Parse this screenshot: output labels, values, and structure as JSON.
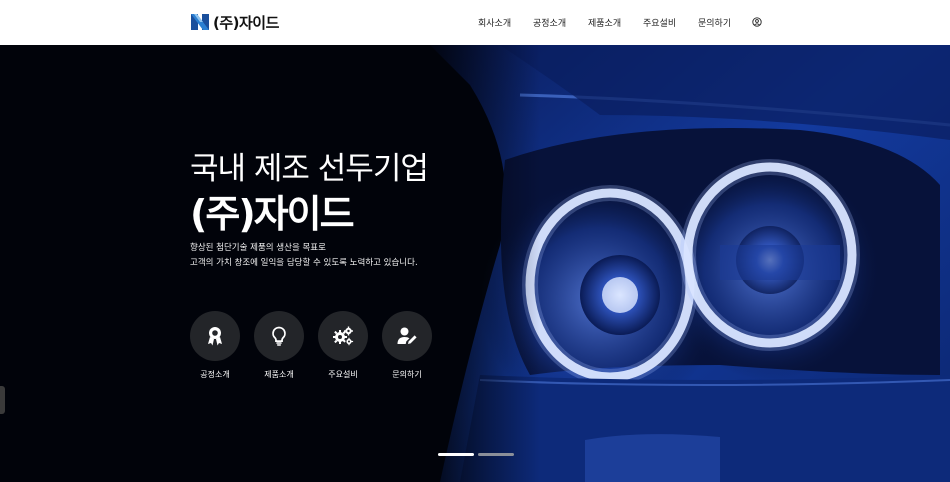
{
  "brand": {
    "name": "(주)자이드",
    "logo_icon": "zaid-logo-icon",
    "colors": {
      "primary": "#1a4f9c",
      "accent": "#2b7fd1"
    }
  },
  "nav": {
    "items": [
      {
        "label": "회사소개"
      },
      {
        "label": "공정소개"
      },
      {
        "label": "제품소개"
      },
      {
        "label": "주요설비"
      },
      {
        "label": "문의하기"
      }
    ],
    "user_icon": "user-circle-icon"
  },
  "hero": {
    "title_line1": "국내 제조 선두기업",
    "title_line2": "(주)자이드",
    "desc_line1": "향상된 첨단기술 제품의 생산을 목표로",
    "desc_line2": "고객의 가치 창조에 일익을 담당할 수 있도록 노력하고 있습니다.",
    "background": "car-headlight-image",
    "quick_links": [
      {
        "label": "공정소개",
        "icon": "award-badge-icon"
      },
      {
        "label": "제품소개",
        "icon": "lightbulb-icon"
      },
      {
        "label": "주요설비",
        "icon": "gears-icon"
      },
      {
        "label": "문의하기",
        "icon": "user-edit-icon"
      }
    ],
    "slides": {
      "count": 2,
      "active": 1
    }
  }
}
